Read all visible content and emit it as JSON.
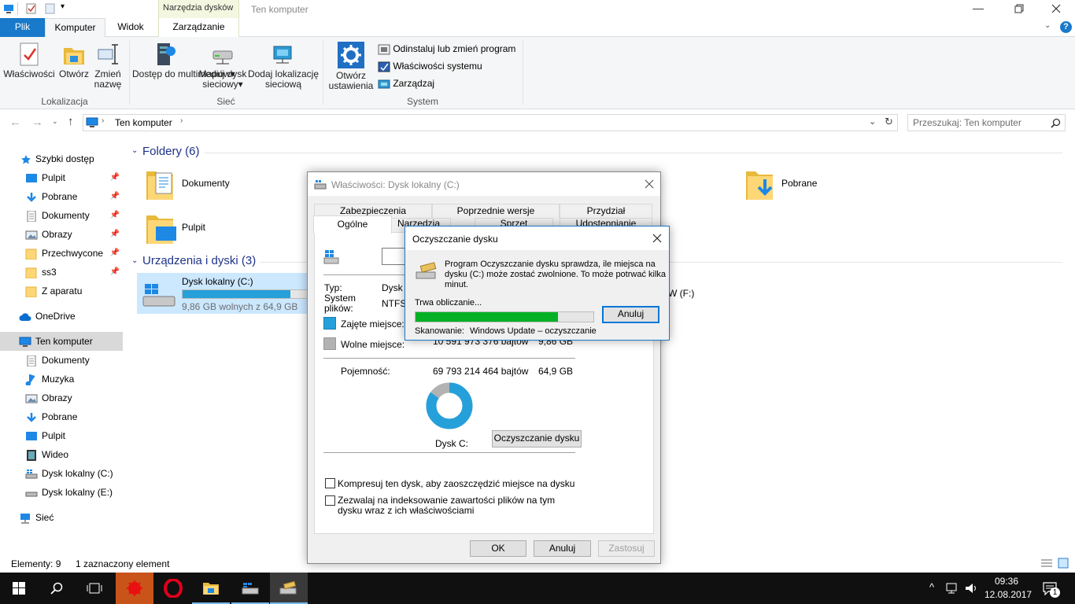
{
  "window": {
    "title": "Ten komputer",
    "context_tab": "Narzędzia dysków",
    "context_subtab": "Zarządzanie"
  },
  "ribbon_tabs": [
    "Plik",
    "Komputer",
    "Widok"
  ],
  "ribbon": {
    "location": {
      "group": "Lokalizacja",
      "buttons": [
        "Właściwości",
        "Otwórz",
        "Zmień nazwę"
      ]
    },
    "network": {
      "group": "Sieć",
      "buttons": [
        "Dostęp do multimediów",
        "Mapuj dysk sieciowy",
        "Dodaj lokalizację sieciową"
      ]
    },
    "system": {
      "group": "System",
      "open_settings": "Otwórz ustawienia",
      "items": [
        "Odinstaluj lub zmień program",
        "Właściwości systemu",
        "Zarządzaj"
      ]
    }
  },
  "address": {
    "path": "Ten komputer",
    "search_placeholder": "Przeszukaj: Ten komputer"
  },
  "nav": {
    "quick_access": "Szybki dostęp",
    "quick_items": [
      "Pulpit",
      "Pobrane",
      "Dokumenty",
      "Obrazy",
      "Przechwycone",
      "ss3",
      "Z aparatu"
    ],
    "onedrive": "OneDrive",
    "this_pc": "Ten komputer",
    "pc_items": [
      "Dokumenty",
      "Muzyka",
      "Obrazy",
      "Pobrane",
      "Pulpit",
      "Wideo",
      "Dysk lokalny (C:)",
      "Dysk lokalny (E:)"
    ],
    "network": "Sieć"
  },
  "content": {
    "folders_header": "Foldery (6)",
    "folders": [
      "Dokumenty",
      "Pobrane",
      "Pulpit"
    ],
    "devices_header": "Urządzenia i dyski (3)",
    "drive_c": {
      "name": "Dysk lokalny (C:)",
      "free": "9,86 GB wolnych z 64,9 GB",
      "used_fraction": 0.848
    },
    "drive_f_partial": "W (F:)"
  },
  "status": {
    "items": "Elementy: 9",
    "selected": "1 zaznaczony element"
  },
  "props": {
    "title": "Właściwości: Dysk lokalny (C:)",
    "tabs_row1": [
      "Zabezpieczenia",
      "Poprzednie wersje",
      "Przydział"
    ],
    "tabs_row2": [
      "Ogólne",
      "Narzędzia",
      "Sprzęt",
      "Udostępnianie"
    ],
    "type_label": "Typ:",
    "type_value": "Dysk l",
    "fs_label": "System plików:",
    "fs_value": "NTFS",
    "used_label": "Zajęte miejsce:",
    "free_label": "Wolne miejsce:",
    "free_bytes": "10 591 973 376 bajtów",
    "free_gb": "9,86 GB",
    "capacity_label": "Pojemność:",
    "capacity_bytes": "69 793 214 464 bajtów",
    "capacity_gb": "64,9 GB",
    "disk_label": "Dysk C:",
    "cleanup_btn": "Oczyszczanie dysku",
    "compress": "Kompresuj ten dysk, aby zaoszczędzić miejsce na dysku",
    "index": "Zezwalaj na indeksowanie zawartości plików na tym dysku wraz z ich właściwościami",
    "ok": "OK",
    "cancel": "Anuluj",
    "apply": "Zastosuj",
    "used_fraction": 0.848
  },
  "cleanup": {
    "title": "Oczyszczanie dysku",
    "message": "Program Oczyszczanie dysku sprawdza, ile miejsca na dysku  (C:) może zostać zwolnione. To może potrwać kilka minut.",
    "calculating": "Trwa obliczanie...",
    "cancel": "Anuluj",
    "scan_label": "Skanowanie:",
    "scan_value": "Windows Update – oczyszczanie",
    "progress": 0.8
  },
  "taskbar": {
    "time": "09:36",
    "date": "12.08.2017",
    "notifications": "1"
  },
  "colors": {
    "accent": "#1979ca",
    "used": "#26a0da",
    "free": "#b2b2b2",
    "progress": "#06b025"
  }
}
